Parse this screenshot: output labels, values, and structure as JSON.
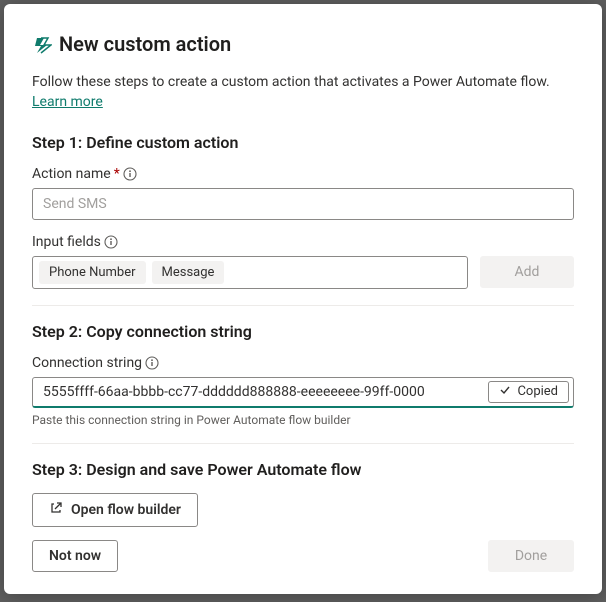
{
  "header": {
    "title": "New custom action"
  },
  "intro": {
    "text": "Follow these steps to create a custom action that activates a Power Automate flow. ",
    "link": "Learn more"
  },
  "step1": {
    "title": "Step 1: Define custom action",
    "action_name_label": "Action name",
    "action_name_placeholder": "Send SMS",
    "input_fields_label": "Input fields",
    "chips": [
      "Phone Number",
      "Message"
    ],
    "add_label": "Add"
  },
  "step2": {
    "title": "Step 2: Copy connection string",
    "conn_label": "Connection string",
    "conn_value": "5555ffff-66aa-bbbb-cc77-dddddd888888-eeeeeeee-99ff-0000",
    "copied_label": "Copied",
    "hint": "Paste this connection string in Power Automate flow builder"
  },
  "step3": {
    "title": "Step 3: Design and save Power Automate flow",
    "open_flow_label": "Open flow builder"
  },
  "footer": {
    "not_now": "Not now",
    "done": "Done"
  }
}
